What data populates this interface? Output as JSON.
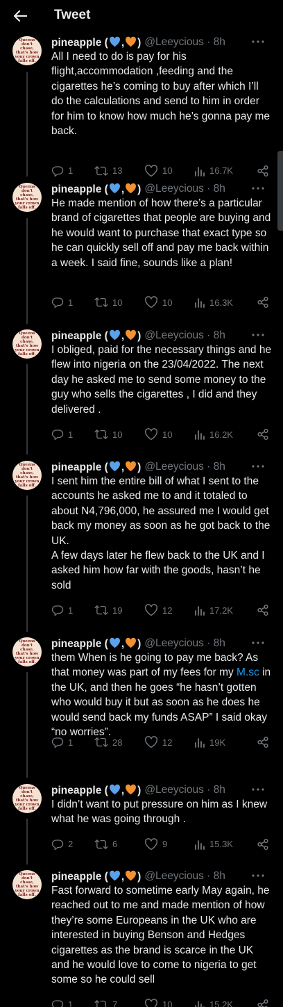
{
  "header": {
    "title": "Tweet"
  },
  "author": {
    "name": "pineapple (",
    "name_close": ")",
    "handle": "@Leeycious · 8h",
    "avatar_text": "Queens don't chase, that's how your crown falls off."
  },
  "colors": {
    "blue_heart": "#5aa0ea",
    "orange_heart": "#f4902f",
    "link": "#1d9bf0",
    "muted": "#71767b"
  },
  "tweets": [
    {
      "text": "All I need to do is pay for his flight,accommodation ,feeding and the cigarettes he’s coming to buy after which I’ll do the calculations and send to him in order for him to know how much he’s gonna pay me back.",
      "replies": "1",
      "retweets": "13",
      "likes": "10",
      "views": "16.7K"
    },
    {
      "text": "He made mention of how there’s a particular brand of cigarettes that people are buying and he would want to purchase that exact type so he can quickly sell off and pay me back within a week. I said fine, sounds like a plan!",
      "replies": "1",
      "retweets": "10",
      "likes": "10",
      "views": "16.3K"
    },
    {
      "text": "I obliged, paid for the necessary things and he flew into nigeria on the 23/04/2022. The next day he asked me to send some money to the guy who sells the cigarettes , I did and they delivered .",
      "replies": "1",
      "retweets": "10",
      "likes": "10",
      "views": "16.2K"
    },
    {
      "text": "I sent him the entire bill of what I sent to the accounts he asked me to and it totaled to about N4,796,000, he assured me I would get back my money as soon as he got back to the UK.\nA few days later he flew back to the UK and I asked him how far with the goods, hasn’t he sold",
      "replies": "1",
      "retweets": "19",
      "likes": "12",
      "views": "17.2K"
    },
    {
      "text_before": "them When is he going to pay me back? As that money was part of my fees for my ",
      "link": "M.sc",
      "text_after": " in the UK, and then he goes “he hasn’t gotten who would buy it but as soon as he does he would send back my funds ASAP” I said okay “no worries”.",
      "replies": "1",
      "retweets": "28",
      "likes": "12",
      "views": "19K"
    },
    {
      "text": "I didn’t want to put pressure on him as I knew what he was going through .",
      "replies": "2",
      "retweets": "6",
      "likes": "9",
      "views": "15.3K"
    },
    {
      "text": "Fast forward to sometime early May again, he reached out to me and made mention of how they’re some Europeans in the UK who are interested in buying Benson and Hedges cigarettes as the brand is scarce in the UK and he would love to come to nigeria to get some so he could sell",
      "replies": "1",
      "retweets": "7",
      "likes": "10",
      "views": "15.2K"
    }
  ]
}
